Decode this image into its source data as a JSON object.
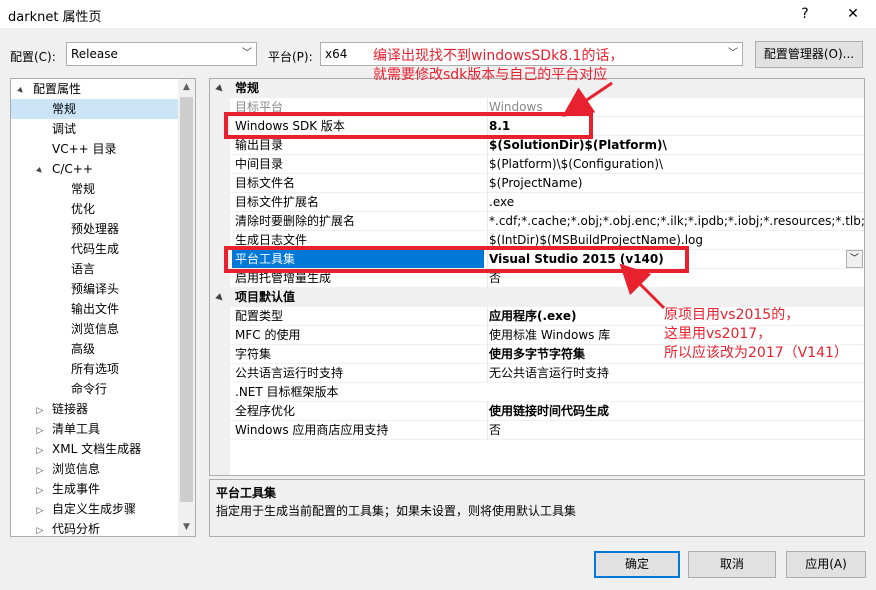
{
  "window": {
    "title": "darknet 属性页",
    "help_glyph": "?",
    "close_glyph": "✕"
  },
  "toolbar": {
    "config_label": "配置(C):",
    "config_value": "Release",
    "platform_label": "平台(P):",
    "platform_value": "x64",
    "config_manager_label": "配置管理器(O)..."
  },
  "tree": {
    "items": [
      {
        "label": "配置属性",
        "level": 0,
        "toggle": "▲"
      },
      {
        "label": "常规",
        "level": 1,
        "toggle": ""
      },
      {
        "label": "调试",
        "level": 1,
        "toggle": ""
      },
      {
        "label": "VC++ 目录",
        "level": 1,
        "toggle": ""
      },
      {
        "label": "C/C++",
        "level": 1,
        "toggle": "▲"
      },
      {
        "label": "常规",
        "level": 2,
        "toggle": ""
      },
      {
        "label": "优化",
        "level": 2,
        "toggle": ""
      },
      {
        "label": "预处理器",
        "level": 2,
        "toggle": ""
      },
      {
        "label": "代码生成",
        "level": 2,
        "toggle": ""
      },
      {
        "label": "语言",
        "level": 2,
        "toggle": ""
      },
      {
        "label": "预编译头",
        "level": 2,
        "toggle": ""
      },
      {
        "label": "输出文件",
        "level": 2,
        "toggle": ""
      },
      {
        "label": "浏览信息",
        "level": 2,
        "toggle": ""
      },
      {
        "label": "高级",
        "level": 2,
        "toggle": ""
      },
      {
        "label": "所有选项",
        "level": 2,
        "toggle": ""
      },
      {
        "label": "命令行",
        "level": 2,
        "toggle": ""
      },
      {
        "label": "链接器",
        "level": 1,
        "toggle": "▷"
      },
      {
        "label": "清单工具",
        "level": 1,
        "toggle": "▷"
      },
      {
        "label": "XML 文档生成器",
        "level": 1,
        "toggle": "▷"
      },
      {
        "label": "浏览信息",
        "level": 1,
        "toggle": "▷"
      },
      {
        "label": "生成事件",
        "level": 1,
        "toggle": "▷"
      },
      {
        "label": "自定义生成步骤",
        "level": 1,
        "toggle": "▷"
      },
      {
        "label": "代码分析",
        "level": 1,
        "toggle": "▷"
      }
    ],
    "selected_index": 1
  },
  "grid": {
    "categories": [
      {
        "label": "常规",
        "toggle": "▲"
      },
      {
        "label": "项目默认值",
        "toggle": "▲"
      }
    ],
    "general_rows": [
      {
        "name": "目标平台",
        "value": "Windows",
        "bold": false,
        "gray": true
      },
      {
        "name": "Windows SDK 版本",
        "value": "8.1",
        "bold": true,
        "gray": false
      },
      {
        "name": "输出目录",
        "value": "$(SolutionDir)$(Platform)\\",
        "bold": true,
        "gray": false
      },
      {
        "name": "中间目录",
        "value": "$(Platform)\\$(Configuration)\\",
        "bold": false,
        "gray": false
      },
      {
        "name": "目标文件名",
        "value": "$(ProjectName)",
        "bold": false,
        "gray": false
      },
      {
        "name": "目标文件扩展名",
        "value": ".exe",
        "bold": false,
        "gray": false
      },
      {
        "name": "清除时要删除的扩展名",
        "value": "*.cdf;*.cache;*.obj;*.obj.enc;*.ilk;*.ipdb;*.iobj;*.resources;*.tlb;*.tli;*.t",
        "bold": false,
        "gray": false
      },
      {
        "name": "生成日志文件",
        "value": "$(IntDir)$(MSBuildProjectName).log",
        "bold": false,
        "gray": false
      },
      {
        "name": "平台工具集",
        "value": "Visual Studio 2015 (v140)",
        "bold": true,
        "gray": false,
        "selected": true
      },
      {
        "name": "启用托管增量生成",
        "value": "否",
        "bold": false,
        "gray": false
      }
    ],
    "defaults_rows": [
      {
        "name": "配置类型",
        "value": "应用程序(.exe)",
        "bold": true
      },
      {
        "name": "MFC 的使用",
        "value": "使用标准 Windows 库",
        "bold": false
      },
      {
        "name": "字符集",
        "value": "使用多字节字符集",
        "bold": true
      },
      {
        "name": "公共语言运行时支持",
        "value": "无公共语言运行时支持",
        "bold": false
      },
      {
        "name": ".NET 目标框架版本",
        "value": "",
        "bold": false
      },
      {
        "name": "全程序优化",
        "value": "使用链接时间代码生成",
        "bold": true
      },
      {
        "name": "Windows 应用商店应用支持",
        "value": "否",
        "bold": false
      }
    ],
    "dropdown_glyph": "﹀"
  },
  "description": {
    "title": "平台工具集",
    "text": "指定用于生成当前配置的工具集；如果未设置，则将使用默认工具集"
  },
  "footer": {
    "ok_label": "确定",
    "cancel_label": "取消",
    "apply_label": "应用(A)"
  },
  "annotations": {
    "top_line1": "编译出现找不到windowsSDk8.1的话，",
    "top_line2": "就需要修改sdk版本与自己的平台对应",
    "bottom_line1": "原项目用vs2015的，",
    "bottom_line2": "这里用vs2017，",
    "bottom_line3": "所以应该改为2017（V141）",
    "color": "#e8212f"
  }
}
